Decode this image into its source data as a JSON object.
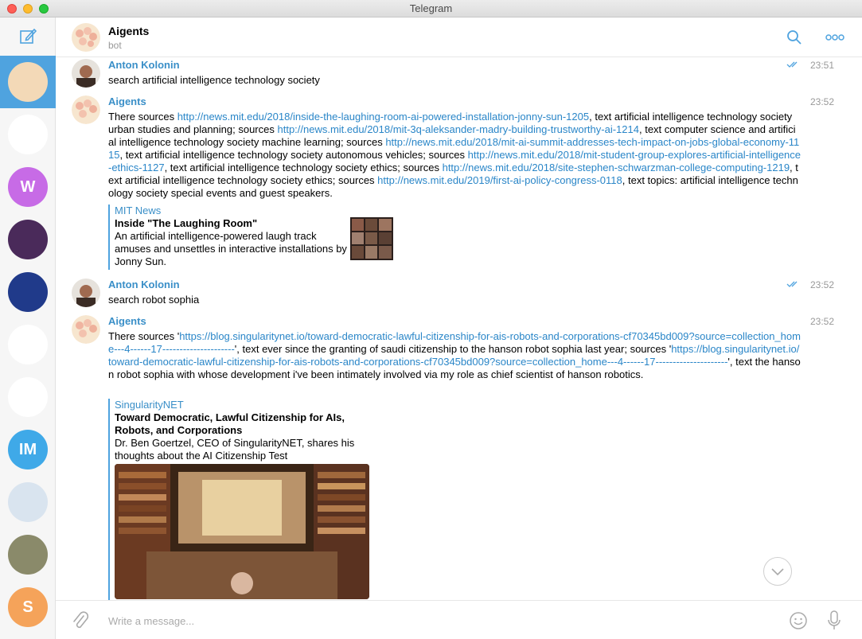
{
  "window": {
    "title": "Telegram"
  },
  "colors": {
    "accent": "#4fa3df",
    "link": "#2a86c8",
    "author": "#3a8fc8"
  },
  "sidebar": {
    "compose_icon": "compose-icon",
    "chats": [
      {
        "name": "chat-aigents",
        "initial": "",
        "color": "#f3d9b7",
        "active": true
      },
      {
        "name": "chat-golos-core",
        "initial": "",
        "color": "#ffffff"
      },
      {
        "name": "chat-w",
        "initial": "W",
        "color": "#c76be6"
      },
      {
        "name": "chat-community",
        "initial": "",
        "color": "#4a2a5a"
      },
      {
        "name": "chat-space",
        "initial": "",
        "color": "#203a8a"
      },
      {
        "name": "chat-hex",
        "initial": "",
        "color": "#ffffff"
      },
      {
        "name": "chat-octopus",
        "initial": "",
        "color": "#ffffff"
      },
      {
        "name": "chat-im",
        "initial": "IM",
        "color": "#3fa9e8"
      },
      {
        "name": "chat-person",
        "initial": "",
        "color": "#d9e4ef"
      },
      {
        "name": "chat-person-2",
        "initial": "",
        "color": "#8a8a6a"
      },
      {
        "name": "chat-s",
        "initial": "S",
        "color": "#f5a35a"
      }
    ]
  },
  "header": {
    "name": "Aigents",
    "status": "bot"
  },
  "messages": [
    {
      "author": "Anton Kolonin",
      "time": "23:51",
      "read": true,
      "text": "search artificial intelligence technology society"
    },
    {
      "author": "Aigents",
      "time": "23:52",
      "parts": [
        {
          "t": "There sources "
        },
        {
          "l": "http://news.mit.edu/2018/inside-the-laughing-room-ai-powered-installation-jonny-sun-1205"
        },
        {
          "t": ", text artificial intelligence technology society urban studies and planning; sources "
        },
        {
          "l": "http://news.mit.edu/2018/mit-3q-aleksander-madry-building-trustworthy-ai-1214"
        },
        {
          "t": ", text computer science and artificial intelligence technology society machine learning; sources "
        },
        {
          "l": "http://news.mit.edu/2018/mit-ai-summit-addresses-tech-impact-on-jobs-global-economy-1115"
        },
        {
          "t": ", text artificial intelligence technology society autonomous vehicles; sources "
        },
        {
          "l": "http://news.mit.edu/2018/mit-student-group-explores-artificial-intelligence-ethics-1127"
        },
        {
          "t": ", text artificial intelligence technology society ethics; sources "
        },
        {
          "l": "http://news.mit.edu/2018/site-stephen-schwarzman-college-computing-1219"
        },
        {
          "t": ", text artificial intelligence technology society ethics; sources "
        },
        {
          "l": "http://news.mit.edu/2019/first-ai-policy-congress-0118"
        },
        {
          "t": ", text topics: artificial intelligence technology society special events and guest speakers."
        }
      ],
      "preview": {
        "site": "MIT News",
        "title": "Inside \"The Laughing Room\"",
        "description": "An artificial intelligence-powered laugh track amuses and unsettles in interactive installations by Jonny Sun."
      }
    },
    {
      "author": "Anton Kolonin",
      "time": "23:52",
      "read": true,
      "text": "search robot sophia"
    },
    {
      "author": "Aigents",
      "time": "23:52",
      "parts": [
        {
          "t": "There sources '"
        },
        {
          "l": "https://blog.singularitynet.io/toward-democratic-lawful-citizenship-for-ais-robots-and-corporations-cf70345bd009?source=collection_home---4------17---------------------"
        },
        {
          "t": "', text ever since the granting of saudi citizenship to the hanson robot sophia last year; sources '"
        },
        {
          "l": "https://blog.singularitynet.io/toward-democratic-lawful-citizenship-for-ais-robots-and-corporations-cf70345bd009?source=collection_home---4------17---------------------"
        },
        {
          "t": "', text the hanson robot sophia with whose development i've been intimately involved via my role as chief scientist of hanson robotics."
        }
      ],
      "preview": {
        "site": "SingularityNET",
        "title": "Toward Democratic, Lawful Citizenship for AIs, Robots, and Corporations",
        "description": "Dr. Ben Goertzel, CEO of SingularityNET, shares his thoughts about the AI Citizenship Test"
      }
    }
  ],
  "composer": {
    "placeholder": "Write a message..."
  }
}
